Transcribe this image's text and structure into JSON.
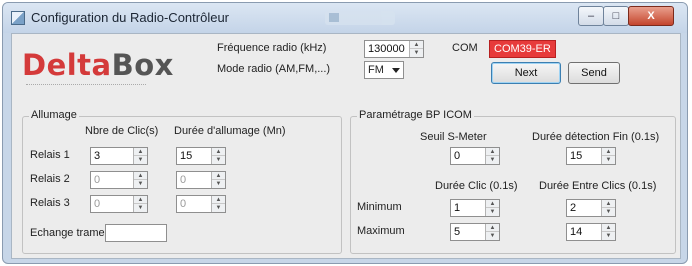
{
  "window": {
    "title": "Configuration du Radio-Contrôleur",
    "buttons": {
      "minimize": "–",
      "maximize": "□",
      "close": "X"
    }
  },
  "logo": {
    "part1": "Delta",
    "part2": "Box"
  },
  "radio": {
    "freq_label": "Fréquence radio (kHz)",
    "freq_value": "130000",
    "mode_label": "Mode radio (AM,FM,...)",
    "mode_value": "FM",
    "com_label": "COM",
    "com_value": "COM39-ER",
    "next_label": "Next",
    "send_label": "Send"
  },
  "allumage": {
    "title": "Allumage",
    "col_clics": "Nbre de Clic(s)",
    "col_duree": "Durée d'allumage (Mn)",
    "rows": [
      {
        "label": "Relais 1",
        "clics": "3",
        "duree": "15",
        "enabled": true
      },
      {
        "label": "Relais 2",
        "clics": "0",
        "duree": "0",
        "enabled": false
      },
      {
        "label": "Relais 3",
        "clics": "0",
        "duree": "0",
        "enabled": false
      }
    ],
    "echange_label": "Echange trames",
    "echange_value": ""
  },
  "bp_icom": {
    "title": "Paramétrage BP ICOM",
    "seuil_label": "Seuil S-Meter",
    "seuil_value": "0",
    "detection_label": "Durée détection Fin (0.1s)",
    "detection_value": "15",
    "duree_clic_label": "Durée Clic (0.1s)",
    "entre_clics_label": "Durée Entre Clics (0.1s)",
    "minimum_label": "Minimum",
    "maximum_label": "Maximum",
    "duree_clic_min": "1",
    "duree_clic_max": "5",
    "entre_clics_min": "2",
    "entre_clics_max": "14"
  }
}
